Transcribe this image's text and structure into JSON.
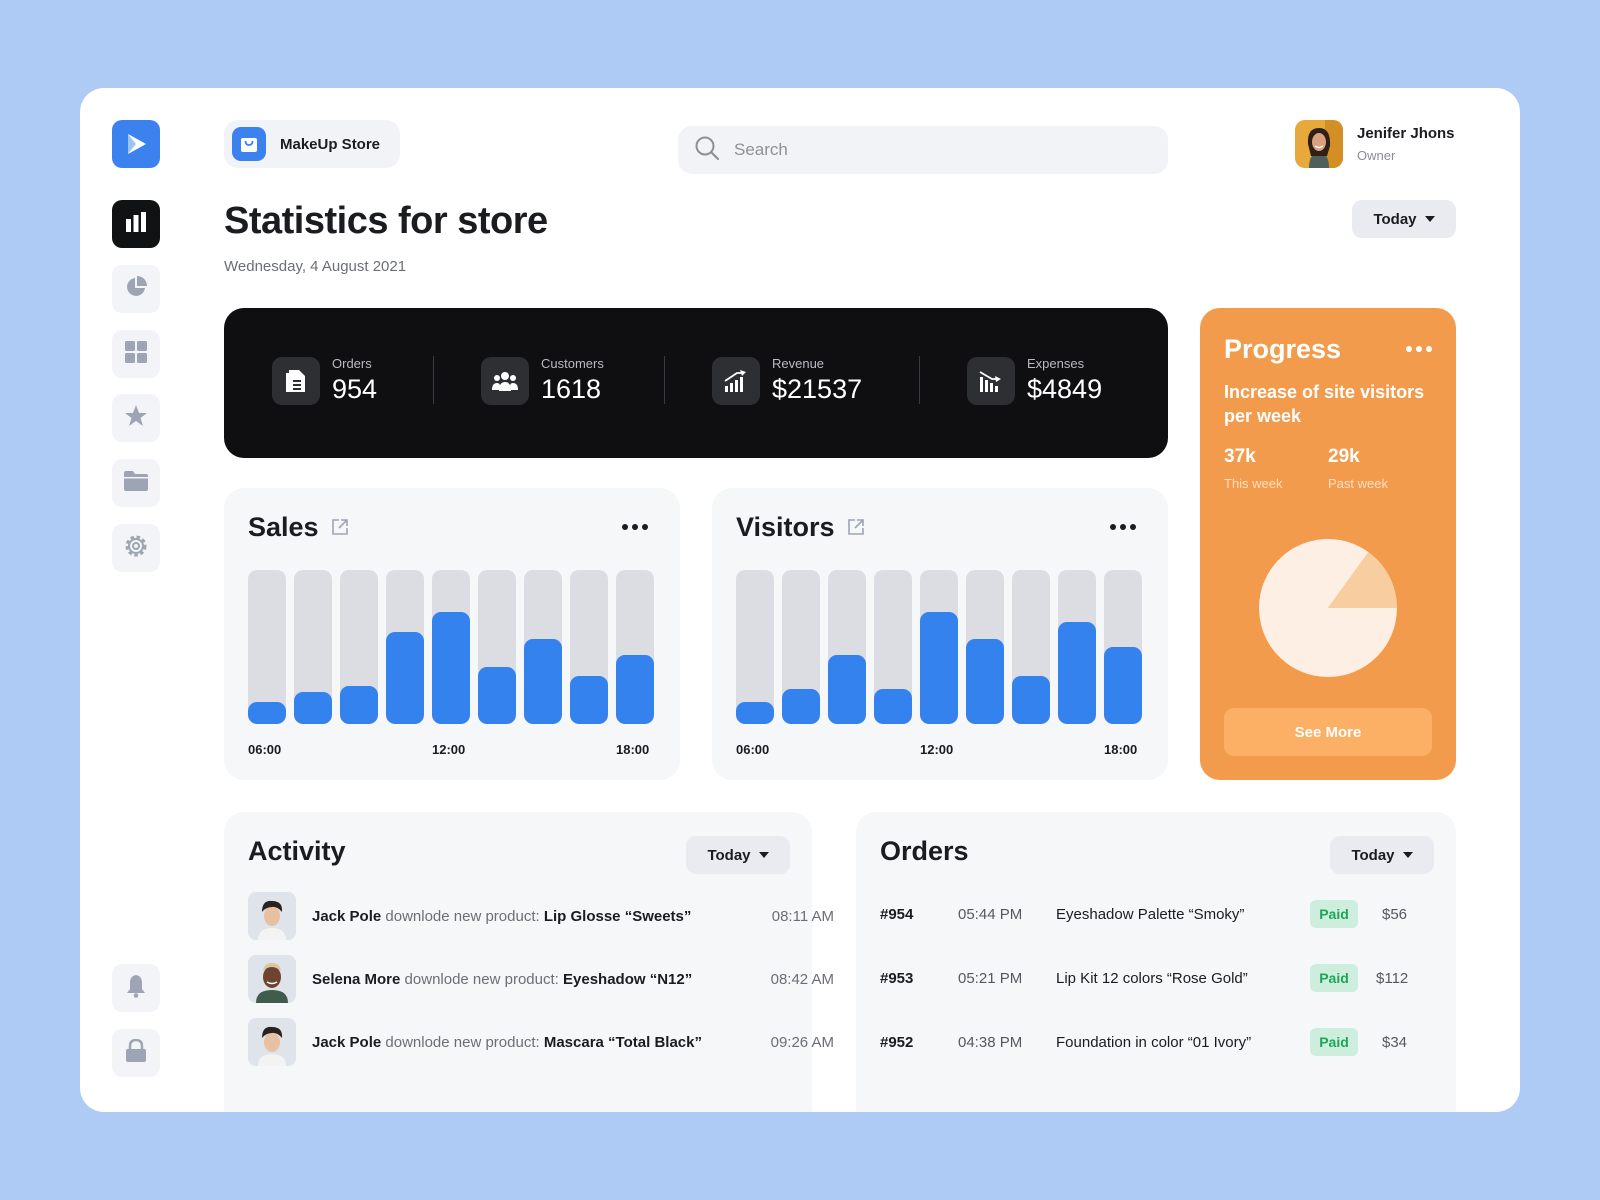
{
  "store": {
    "name": "MakeUp Store"
  },
  "search": {
    "placeholder": "Search"
  },
  "user": {
    "name": "Jenifer Jhons",
    "role": "Owner"
  },
  "page": {
    "title": "Statistics for store",
    "date": "Wednesday, 4 August 2021",
    "period": "Today"
  },
  "nav": {
    "items": [
      "statistics",
      "reports",
      "dashboard",
      "favorites",
      "folders",
      "settings"
    ],
    "bottom": [
      "notifications",
      "lock"
    ]
  },
  "stats": [
    {
      "label": "Orders",
      "value": "954",
      "icon": "document-icon"
    },
    {
      "label": "Customers",
      "value": "1618",
      "icon": "users-icon"
    },
    {
      "label": "Revenue",
      "value": "$21537",
      "icon": "chart-up-icon"
    },
    {
      "label": "Expenses",
      "value": "$4849",
      "icon": "chart-down-icon"
    }
  ],
  "sales": {
    "title": "Sales",
    "x_labels": [
      "06:00",
      "12:00",
      "18:00"
    ],
    "chart_data": {
      "type": "bar",
      "values": [
        0.14,
        0.21,
        0.25,
        0.6,
        0.73,
        0.37,
        0.55,
        0.31,
        0.45
      ]
    }
  },
  "visitors": {
    "title": "Visitors",
    "x_labels": [
      "06:00",
      "12:00",
      "18:00"
    ],
    "chart_data": {
      "type": "bar",
      "values": [
        0.14,
        0.23,
        0.45,
        0.23,
        0.73,
        0.55,
        0.31,
        0.66,
        0.5
      ]
    }
  },
  "progress": {
    "title": "Progress",
    "subtitle": "Increase of site visitors per week",
    "this_week": {
      "value": "37k",
      "label": "This week"
    },
    "past_week": {
      "value": "29k",
      "label": "Past week"
    },
    "chart_data": {
      "type": "pie",
      "values": [
        0.85,
        0.15
      ]
    },
    "button": "See More",
    "colors": {
      "background": "#f39b4d",
      "pie_main": "#fdefe3",
      "pie_slice": "#f8cda0"
    }
  },
  "activity": {
    "title": "Activity",
    "period": "Today",
    "items": [
      {
        "user": "Jack Pole",
        "action": "downlode new product:",
        "product": "Lip Glosse “Sweets”",
        "time": "08:11 AM"
      },
      {
        "user": "Selena More",
        "action": "downlode new product:",
        "product": "Eyeshadow “N12”",
        "time": "08:42 AM"
      },
      {
        "user": "Jack Pole",
        "action": "downlode new product:",
        "product": "Mascara “Total Black”",
        "time": "09:26 AM"
      }
    ]
  },
  "orders": {
    "title": "Orders",
    "period": "Today",
    "rows": [
      {
        "id": "#954",
        "time": "05:44 PM",
        "product": "Eyeshadow Palette “Smoky”",
        "status": "Paid",
        "amount": "$56"
      },
      {
        "id": "#953",
        "time": "05:21 PM",
        "product": "Lip Kit 12 colors “Rose Gold”",
        "status": "Paid",
        "amount": "$112"
      },
      {
        "id": "#952",
        "time": "04:38 PM",
        "product": "Foundation in color “01 Ivory”",
        "status": "Paid",
        "amount": "$34"
      }
    ]
  },
  "colors": {
    "accent": "#3482ed",
    "dark": "#0f0f11",
    "paid_bg": "#cdeedd",
    "paid_text": "#21a35a"
  }
}
